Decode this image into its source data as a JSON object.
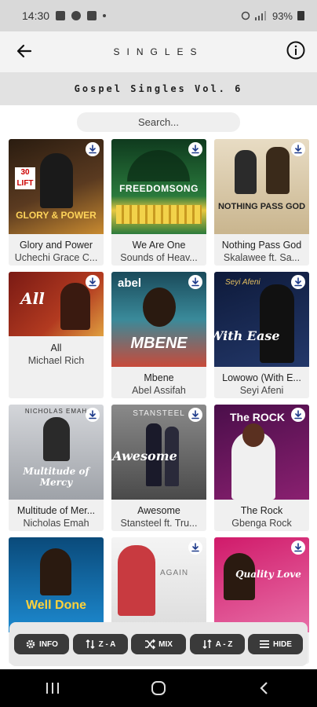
{
  "status_bar": {
    "time": "14:30",
    "battery": "93%"
  },
  "header": {
    "title": "SINGLES"
  },
  "subheader": {
    "title": "Gospel Singles Vol. 6"
  },
  "search": {
    "placeholder": "Search..."
  },
  "songs": [
    {
      "title": "Glory and Power",
      "artist": "Uchechi Grace C...",
      "cover_text": "GLORY & POWER",
      "cover_color": "#3b2a1a"
    },
    {
      "title": "We Are One",
      "artist": "Sounds of Heav...",
      "cover_text": "FREEDOMSONG",
      "cover_color": "#1f5a32"
    },
    {
      "title": "Nothing Pass God",
      "artist": "Skalawee ft. Sa...",
      "cover_text": "NOTHING PASS GOD",
      "cover_color": "#d8cbb0"
    },
    {
      "title": "All",
      "artist": "Michael Rich",
      "cover_text": "All",
      "cover_color": "#8c2a1e"
    },
    {
      "title": "Mbene",
      "artist": "Abel Assifah",
      "cover_text": "MBENE",
      "cover_color": "#2f6a7a"
    },
    {
      "title": "Lowowo (With E...",
      "artist": "Seyi Afeni",
      "cover_text": "With Ease",
      "cover_color": "#1e2a55"
    },
    {
      "title": "Multitude of Mer...",
      "artist": "Nicholas Emah",
      "cover_text": "Multitude of Mercy",
      "cover_color": "#b9bcc2"
    },
    {
      "title": "Awesome",
      "artist": "Stansteel ft. Tru...",
      "cover_text": "Awesome",
      "cover_color": "#5a5a5a"
    },
    {
      "title": "The Rock",
      "artist": "Gbenga Rock",
      "cover_text": "The ROCK",
      "cover_color": "#6a1a5a"
    },
    {
      "cover_text": "Well Done",
      "cover_color": "#1d6fa0"
    },
    {
      "cover_text": "",
      "cover_color": "#e5e5e5"
    },
    {
      "cover_text": "Quality Love",
      "cover_color": "#c0307a"
    }
  ],
  "toolbar": {
    "info": "INFO",
    "za": "Z - A",
    "mix": "MIX",
    "az": "A - Z",
    "hide": "HIDE"
  },
  "icons": [
    "back-arrow-icon",
    "info-icon",
    "download-icon",
    "gear-icon",
    "sort-icon",
    "shuffle-icon",
    "menu-icon",
    "recents-icon",
    "home-icon",
    "back-icon"
  ]
}
